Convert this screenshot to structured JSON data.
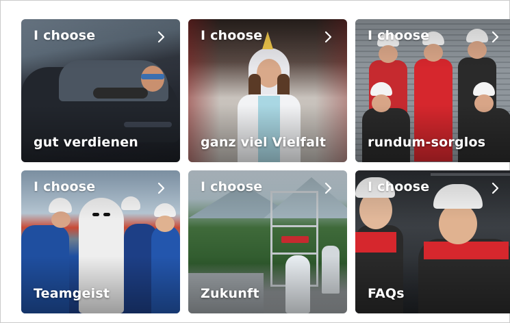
{
  "tiles": [
    {
      "kicker": "I choose",
      "title": "gut verdienen"
    },
    {
      "kicker": "I choose",
      "title": "ganz viel Vielfalt"
    },
    {
      "kicker": "I choose",
      "title": "rundum-sorglos"
    },
    {
      "kicker": "I choose",
      "title": "Teamgeist"
    },
    {
      "kicker": "I choose",
      "title": "Zukunft"
    },
    {
      "kicker": "I choose",
      "title": "FAQs"
    }
  ],
  "colors": {
    "text": "#ffffff",
    "frame_border": "#c9c9c9",
    "workwear_red": "#d6272d",
    "workwear_blue": "#1f4fa0"
  },
  "icons": [
    "chevron-right-icon"
  ]
}
